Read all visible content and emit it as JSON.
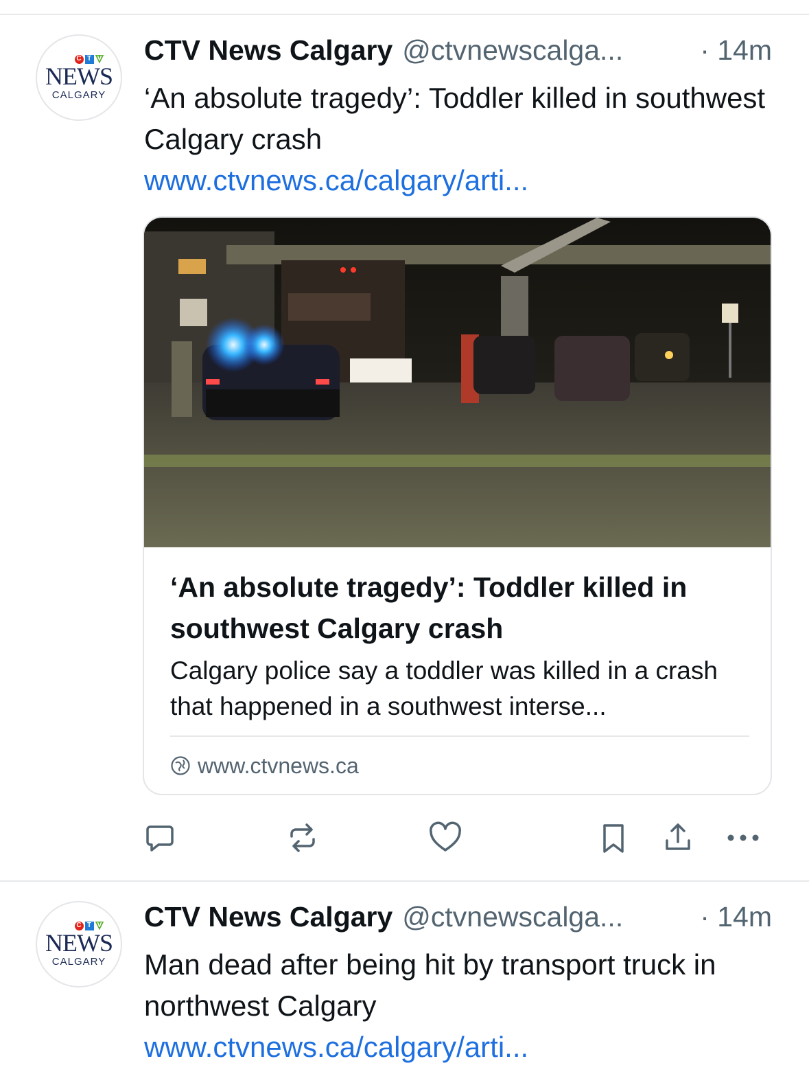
{
  "posts": [
    {
      "author_name": "CTV News Calgary",
      "author_handle": "@ctvnewscalga...",
      "time": "· 14m",
      "avatar": {
        "logo_letters": [
          "C",
          "T",
          "V"
        ],
        "logo_colors": [
          "#e2231a",
          "#1f7bd6",
          "#5cb031"
        ],
        "logo_word": "NEWS",
        "logo_city": "CALGARY"
      },
      "text": "‘An absolute tragedy’: Toddler killed in southwest Calgary crash",
      "link": "www.ctvnews.ca/calgary/arti...",
      "card": {
        "image_icon": "police-scene-photo",
        "title": "‘An absolute tragedy’: Toddler killed in southwest Calgary crash",
        "description": "Calgary police say a toddler was killed in a crash that happened in a southwest interse...",
        "domain": "www.ctvnews.ca",
        "domain_icon": "globe-icon"
      },
      "actions": [
        "reply-icon",
        "repost-icon",
        "like-icon",
        "bookmark-icon",
        "share-icon",
        "more-icon"
      ]
    },
    {
      "author_name": "CTV News Calgary",
      "author_handle": "@ctvnewscalga...",
      "time": "· 14m",
      "avatar": {
        "logo_letters": [
          "C",
          "T",
          "V"
        ],
        "logo_colors": [
          "#e2231a",
          "#1f7bd6",
          "#5cb031"
        ],
        "logo_word": "NEWS",
        "logo_city": "CALGARY"
      },
      "text": "Man dead after being hit by transport truck in northwest Calgary",
      "link": "www.ctvnews.ca/calgary/arti..."
    }
  ],
  "colors": {
    "link": "#1d6fe0",
    "secondary_text": "#536471",
    "action_icon": "#536471",
    "divider": "#e6e8ea"
  }
}
